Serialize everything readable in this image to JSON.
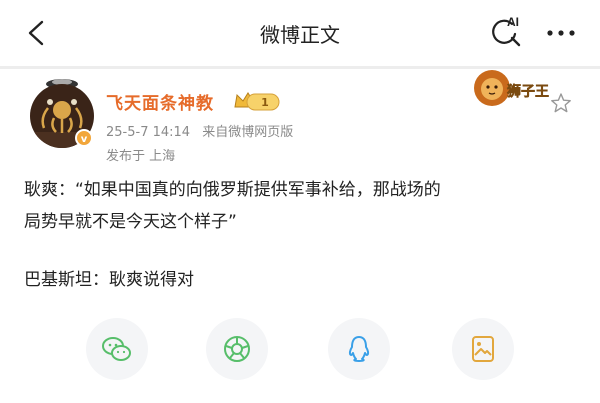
{
  "header": {
    "title": "微博正文",
    "icons": [
      "back-icon",
      "ai-search-icon",
      "more-icon"
    ]
  },
  "post": {
    "username": "飞天面条神教",
    "badge_level": "1",
    "timestamp": "25-5-7 14:14",
    "source": "来自微博网页版",
    "location": "发布于 上海",
    "lion_badge_text": "狮子王",
    "lines": [
      "耿爽：“如果中国真的向俄罗斯提供军事补给，那战场的",
      "局势早就不是今天这个样子”",
      "",
      "巴基斯坦：耿爽说得对"
    ]
  },
  "share": {
    "items": [
      "wechat-icon",
      "moments-icon",
      "qq-icon",
      "save-image-icon"
    ],
    "colors": {
      "wechat": "#57be6a",
      "moments": "#57be6a",
      "qq": "#3aa0e8",
      "image": "#e2a73d"
    }
  },
  "colors": {
    "username": "#e66b2a",
    "meta": "#8a8a8a"
  }
}
